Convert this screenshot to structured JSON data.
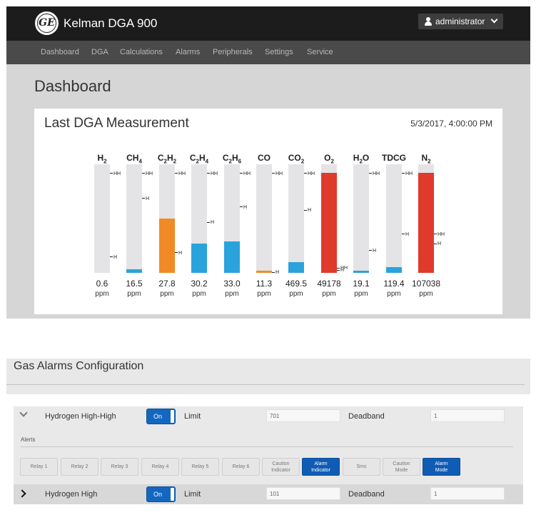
{
  "app": {
    "logo_text": "GE",
    "title": "Kelman DGA 900",
    "user": "administrator"
  },
  "nav": [
    "Dashboard",
    "DGA",
    "Calculations",
    "Alarms",
    "Peripherals",
    "Settings",
    "Service"
  ],
  "page_title": "Dashboard",
  "card": {
    "title": "Last DGA Measurement",
    "timestamp": "5/3/2017, 4:00:00 PM",
    "unit": "ppm",
    "gases": [
      {
        "base": "H",
        "sub": "2",
        "tail": "",
        "sub2": "",
        "value": "0.6",
        "fill": 0.0,
        "color": "#2aa3dc",
        "hh": 0.91,
        "h": 0.14
      },
      {
        "base": "CH",
        "sub": "4",
        "tail": "",
        "sub2": "",
        "value": "16.5",
        "fill": 0.03,
        "color": "#2aa3dc",
        "hh": 0.91,
        "h": 0.68
      },
      {
        "base": "C",
        "sub": "2",
        "tail": "H",
        "sub2": "2",
        "value": "27.8",
        "fill": 0.5,
        "color": "#f08a24",
        "hh": 0.91,
        "h": 0.18
      },
      {
        "base": "C",
        "sub": "2",
        "tail": "H",
        "sub2": "4",
        "value": "30.2",
        "fill": 0.27,
        "color": "#2aa3dc",
        "hh": 0.91,
        "h": 0.46
      },
      {
        "base": "C",
        "sub": "2",
        "tail": "H",
        "sub2": "6",
        "value": "33.0",
        "fill": 0.29,
        "color": "#2aa3dc",
        "hh": 0.91,
        "h": 0.6
      },
      {
        "base": "CO",
        "sub": "",
        "tail": "",
        "sub2": "",
        "value": "11.3",
        "fill": 0.015,
        "color": "#f08a24",
        "hh": 0.91,
        "h": 0.0
      },
      {
        "base": "CO",
        "sub": "2",
        "tail": "",
        "sub2": "",
        "value": "469.5",
        "fill": 0.1,
        "color": "#2aa3dc",
        "hh": 0.91,
        "h": 0.57
      },
      {
        "base": "O",
        "sub": "2",
        "tail": "",
        "sub2": "",
        "value": "49178",
        "fill": 0.92,
        "color": "#e03a2c",
        "hh": 0.04,
        "h": 0.02
      },
      {
        "base": "H",
        "sub": "2",
        "tail": "O",
        "sub2": "",
        "value": "19.1",
        "fill": 0.02,
        "color": "#2aa3dc",
        "hh": 0.91,
        "h": 0.2
      },
      {
        "base": "TDCG",
        "sub": "",
        "tail": "",
        "sub2": "",
        "value": "119.4",
        "fill": 0.05,
        "color": "#2aa3dc",
        "hh": 0.91,
        "h": 0.35
      },
      {
        "base": "N",
        "sub": "2",
        "tail": "",
        "sub2": "",
        "value": "107038",
        "fill": 0.92,
        "color": "#e03a2c",
        "hh": 0.35,
        "h": 0.26
      }
    ]
  },
  "markers": {
    "hh": "HH",
    "h": "H"
  },
  "alarms": {
    "title": "Gas Alarms Configuration",
    "limit_label": "Limit",
    "deadband_label": "Deadband",
    "alerts_label": "Alerts",
    "rows": [
      {
        "name": "Hydrogen High-High",
        "toggle": "On",
        "limit": "701",
        "deadband": "1"
      },
      {
        "name": "Hydrogen High",
        "toggle": "On",
        "limit": "101",
        "deadband": "1"
      }
    ],
    "chips": [
      {
        "l1": "Relay 1",
        "l2": "",
        "on": false
      },
      {
        "l1": "Relay 2",
        "l2": "",
        "on": false
      },
      {
        "l1": "Relay 3",
        "l2": "",
        "on": false
      },
      {
        "l1": "Relay 4",
        "l2": "",
        "on": false
      },
      {
        "l1": "Relay 5",
        "l2": "",
        "on": false
      },
      {
        "l1": "Relay 6",
        "l2": "",
        "on": false
      },
      {
        "l1": "Caution",
        "l2": "Indicator",
        "on": false
      },
      {
        "l1": "Alarm",
        "l2": "Indicator",
        "on": true
      },
      {
        "l1": "Sms",
        "l2": "",
        "on": false
      },
      {
        "l1": "Caution",
        "l2": "Mode",
        "on": false
      },
      {
        "l1": "Alarm",
        "l2": "Mode",
        "on": true
      }
    ]
  }
}
